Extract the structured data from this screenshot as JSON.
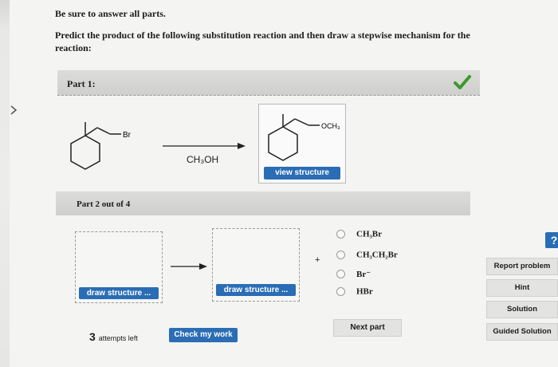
{
  "header": {
    "instructions": "Be sure to answer all parts.",
    "question": "Predict the product of the following substitution reaction and then draw a stepwise mechanism for the reaction:"
  },
  "part1": {
    "label": "Part 1:",
    "reactant_substituent": "Br",
    "reagent": "CH₃OH",
    "product_substituent": "OCH₃",
    "view_structure_label": "view structure",
    "status_icon": "checkmark-icon",
    "status_color": "#3a9a2a"
  },
  "part2": {
    "label": "Part 2 out of 4",
    "draw_structure_label_1": "draw structure ...",
    "draw_structure_label_2": "draw structure ...",
    "plus": "+",
    "options": [
      {
        "label": "CH₃Br"
      },
      {
        "label": "CH₃CH₂Br"
      },
      {
        "label": "Br⁻"
      },
      {
        "label": "HBr"
      }
    ]
  },
  "sidebar": {
    "help_icon_text": "?",
    "report_problem": "Report problem",
    "hint": "Hint",
    "solution": "Solution",
    "guided_solution": "Guided Solution"
  },
  "footer": {
    "attempts_count": "3",
    "attempts_text": "attempts left",
    "check_label": "Check my work",
    "next_part_label": "Next part"
  },
  "colors": {
    "accent_blue": "#2a6db5",
    "check_green": "#3a9a2a"
  }
}
